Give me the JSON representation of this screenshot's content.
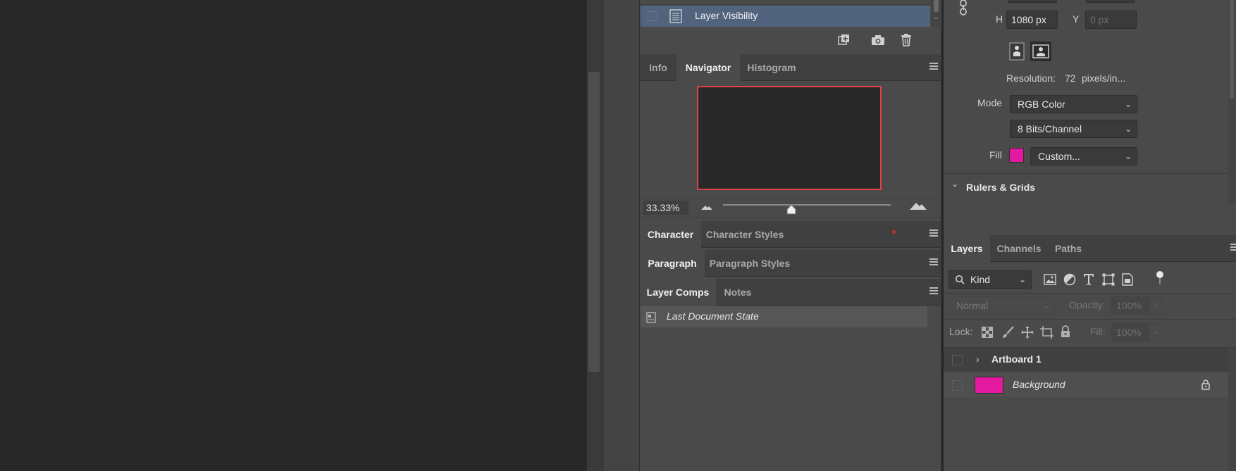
{
  "history": {
    "item_label": "Layer Visibility"
  },
  "navigator_panel": {
    "tabs": [
      "Info",
      "Navigator",
      "Histogram"
    ],
    "active_tab": "Navigator",
    "zoom": "33.33%",
    "zoom_slider_fraction": 0.42
  },
  "character_panel": {
    "tabs": [
      "Character",
      "Character Styles"
    ]
  },
  "paragraph_panel": {
    "tabs": [
      "Paragraph",
      "Paragraph Styles"
    ]
  },
  "layer_comps_panel": {
    "tabs": [
      "Layer Comps",
      "Notes"
    ],
    "state_label": "Last Document State"
  },
  "properties": {
    "h_label": "H",
    "h_value": "1080 px",
    "y_label": "Y",
    "y_placeholder": "0 px",
    "resolution_label": "Resolution:",
    "resolution_value": "72",
    "resolution_unit": "pixels/in...",
    "mode_label": "Mode",
    "mode_value": "RGB Color",
    "bits_value": "8 Bits/Channel",
    "fill_label": "Fill",
    "fill_value": "Custom...",
    "fill_color": "#e3199f",
    "section_rulers": "Rulers & Grids"
  },
  "layers_panel": {
    "tabs": [
      "Layers",
      "Channels",
      "Paths"
    ],
    "filter_kind": "Kind",
    "blend_mode": "Normal",
    "opacity_label": "Opacity:",
    "opacity_value": "100%",
    "lock_label": "Lock:",
    "fill_label": "Fill:",
    "fill_value": "100%",
    "layers": [
      {
        "name": "Artboard 1",
        "type": "artboard"
      },
      {
        "name": "Background",
        "type": "layer",
        "thumb_color": "#e3199f"
      }
    ]
  }
}
